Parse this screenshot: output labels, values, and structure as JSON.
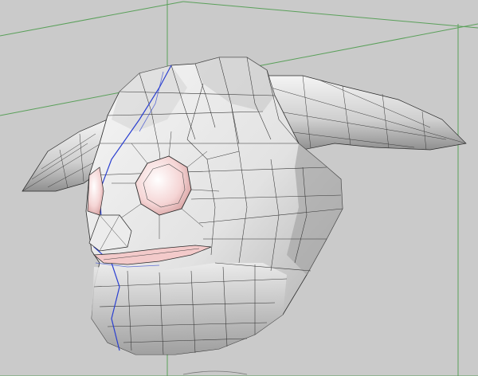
{
  "viewport": {
    "background_color": "#cacaca",
    "grid_line_color": "#66b466",
    "bounding_box_color": "#5aa05a",
    "mesh_fill": "#e8e8e8",
    "mesh_shadow": "#9d9d9d",
    "wire_color": "#2a2a2a",
    "seam_color": "#2a3fd0",
    "inner_color": "#f0c8c8",
    "model_name": ""
  }
}
